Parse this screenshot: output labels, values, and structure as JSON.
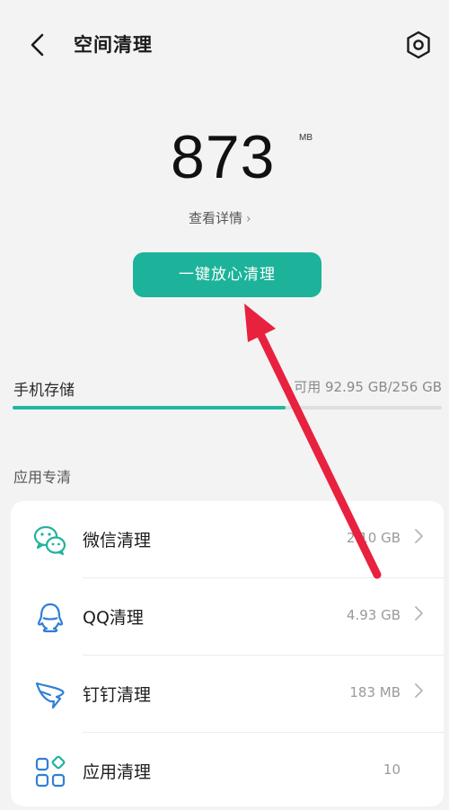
{
  "header": {
    "title": "空间清理",
    "back_icon": "back-arrow-icon",
    "settings_icon": "gear-icon"
  },
  "summary": {
    "size_value": "873",
    "size_unit": "MB",
    "details_label": "查看详情",
    "clean_button_label": "一键放心清理"
  },
  "storage": {
    "label": "手机存储",
    "info": "可用 92.95 GB/256 GB",
    "used_fraction": 0.637
  },
  "apps_section": {
    "title": "应用专清",
    "items": [
      {
        "name": "微信清理",
        "size": "2.10 GB",
        "icon": "wechat-icon"
      },
      {
        "name": "QQ清理",
        "size": "4.93 GB",
        "icon": "qq-icon"
      },
      {
        "name": "钉钉清理",
        "size": "183 MB",
        "icon": "dingtalk-icon"
      },
      {
        "name": "应用清理",
        "size": "10",
        "icon": "apps-grid-icon"
      }
    ]
  },
  "colors": {
    "accent": "#1cb39a",
    "annotation_arrow": "#e8213f"
  }
}
